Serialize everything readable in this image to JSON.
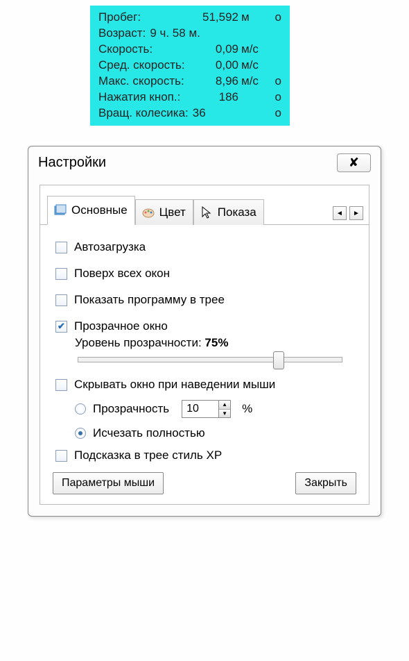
{
  "overlay": {
    "rows": [
      {
        "label": "Пробег:",
        "value": "51,592",
        "unit": "м",
        "reset": "о"
      },
      {
        "label": "Возраст:",
        "value": "9 ч. 58 м.",
        "unit": "",
        "reset": ""
      },
      {
        "label": "Скорость:",
        "value": "0,09",
        "unit": "м/с",
        "reset": ""
      },
      {
        "label": "Сред. скорость:",
        "value": "0,00",
        "unit": "м/с",
        "reset": ""
      },
      {
        "label": "Макс. скорость:",
        "value": "8,96",
        "unit": "м/с",
        "reset": "о"
      },
      {
        "label": "Нажатия кноп.:",
        "value": "186",
        "unit": "",
        "reset": "о"
      },
      {
        "label": "Вращ. колесика:",
        "value": "36",
        "unit": "",
        "reset": "о"
      }
    ]
  },
  "dialog": {
    "title": "Настройки",
    "close_glyph": "✕",
    "tabs": {
      "main": "Основные",
      "color": "Цвет",
      "show": "Показа"
    },
    "opts": {
      "autoload": "Автозагрузка",
      "ontop": "Поверх всех окон",
      "tray": "Показать программу в трее",
      "transparent": "Прозрачное окно",
      "transp_level_label": "Уровень прозрачности:",
      "transp_level_value": "75%",
      "hide_on_hover": "Скрывать окно при наведении мыши",
      "sub_transp": "Прозрачность",
      "sub_transp_val": "10",
      "percent": "%",
      "sub_vanish": "Исчезать полностью",
      "tooltip_xp": "Подсказка в трее стиль XP"
    },
    "buttons": {
      "mouse_params": "Параметры мыши",
      "close": "Закрыть"
    }
  }
}
